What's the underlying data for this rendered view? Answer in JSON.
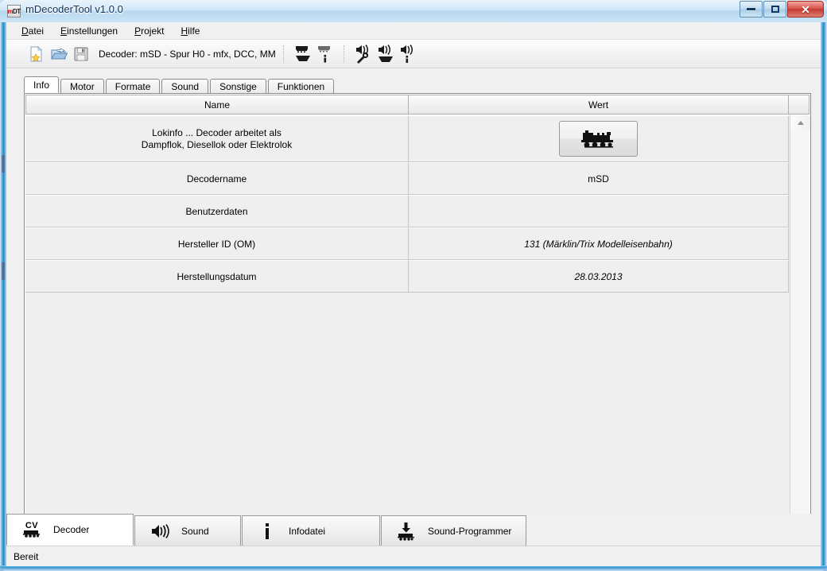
{
  "window": {
    "title": "mDecoderTool v1.0.0",
    "icon": "mdt-app-icon",
    "controls": {
      "minimize": "minimize-button",
      "restore": "restore-button",
      "close": "close-button"
    }
  },
  "menubar": {
    "items": [
      {
        "label": "Datei",
        "accel": "D"
      },
      {
        "label": "Einstellungen",
        "accel": "E"
      },
      {
        "label": "Projekt",
        "accel": "P"
      },
      {
        "label": "Hilfe",
        "accel": "H"
      }
    ]
  },
  "toolbar": {
    "decoder_label": "Decoder: mSD - Spur H0 - mfx, DCC, MM",
    "buttons": [
      {
        "name": "new-file-icon"
      },
      {
        "name": "open-folder-icon"
      },
      {
        "name": "save-disk-icon"
      },
      {
        "name": "open-decoder-icon"
      },
      {
        "name": "decoder-info-icon"
      },
      {
        "name": "sound-tools-icon"
      },
      {
        "name": "open-sound-icon"
      },
      {
        "name": "sound-info-icon"
      }
    ]
  },
  "tabs": {
    "active": "Info",
    "items": [
      "Info",
      "Motor",
      "Formate",
      "Sound",
      "Sonstige",
      "Funktionen"
    ]
  },
  "grid": {
    "columns": [
      "Name",
      "Wert"
    ],
    "rows": [
      {
        "name_line1": "Lokinfo ... Decoder arbeitet als",
        "name_line2": "Dampflok, Diesellok oder Elektrolok",
        "value": "",
        "value_type": "loco-button",
        "italic": false
      },
      {
        "name": "Decodername",
        "value": "mSD",
        "value_type": "text",
        "italic": false
      },
      {
        "name": "Benutzerdaten",
        "value": "",
        "value_type": "text",
        "italic": false
      },
      {
        "name": "Hersteller ID (OM)",
        "value": "131 (Märklin/Trix Modelleisenbahn)",
        "value_type": "text",
        "italic": true
      },
      {
        "name": "Herstellungsdatum",
        "value": "28.03.2013",
        "value_type": "text",
        "italic": true
      }
    ]
  },
  "bottom_nav": {
    "active": "Decoder",
    "items": [
      {
        "label": "Decoder",
        "icon": "cv-loco-icon",
        "cv_text": "CV"
      },
      {
        "label": "Sound",
        "icon": "speaker-icon"
      },
      {
        "label": "Infodatei",
        "icon": "info-icon"
      },
      {
        "label": "Sound-Programmer",
        "icon": "download-loco-icon"
      }
    ]
  },
  "statusbar": {
    "text": "Bereit"
  },
  "colors": {
    "accent": "#2f9ad6",
    "panel_bg": "#efefef",
    "title_text": "#12325c",
    "close_button": "#c33a30"
  }
}
